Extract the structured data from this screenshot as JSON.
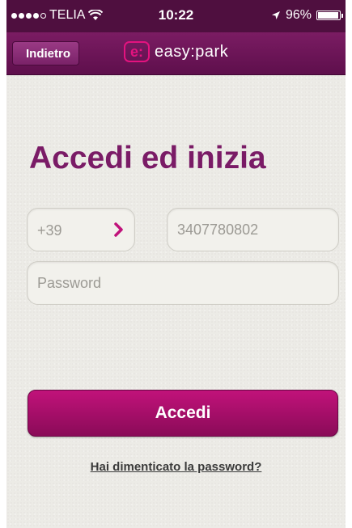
{
  "status_bar": {
    "carrier": "TELIA",
    "time": "10:22",
    "battery": "96%",
    "battery_level": 0.96,
    "icons": [
      "signal-dots-icon",
      "wifi-icon",
      "location-arrow-icon",
      "battery-icon"
    ]
  },
  "nav": {
    "back_label": "Indietro",
    "logo_mark": "e:",
    "logo_text": "easy:park",
    "brand_color": "#e3137f",
    "bar_color": "#6a1554"
  },
  "login": {
    "title": "Accedi ed inizia",
    "country_code": "+39",
    "phone_value": "3407780802",
    "password_placeholder": "Password",
    "submit_label": "Accedi",
    "forgot_label": "Hai dimenticato la password?",
    "title_color": "#7a1b66",
    "button_color": "#b0106f"
  }
}
